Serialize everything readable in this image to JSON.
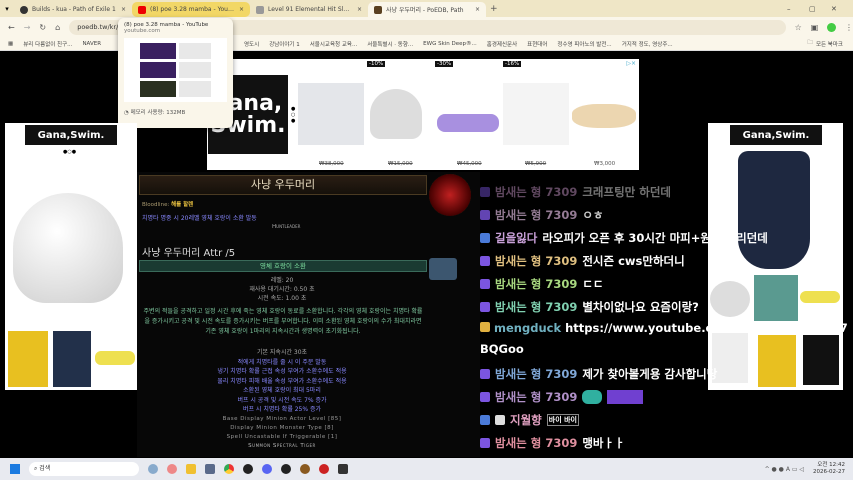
{
  "tabs": [
    {
      "title": "Builds - kua - Path of Exile 1",
      "active": false
    },
    {
      "title": "(8) poe 3.28 mamba - YouTube",
      "active": false,
      "highlighted": true
    },
    {
      "title": "Level 91 Elemental Hit Slayer",
      "active": false
    },
    {
      "title": "사냥 우두머리 - PoEDB, Path",
      "active": true
    }
  ],
  "address": {
    "url": "poedb.tw/kr/"
  },
  "bookmarks": [
    "뷰리 다름없이 친구...",
    "NAVER",
    "영도시",
    "강남이야기 1",
    "서울시교육청 교육...",
    "서울특별시 · 동향...",
    "EWG Skin Deep®...",
    "홈경제신문사",
    "표현대어",
    "정수영 피아노의 발전...",
    "거지적 정도, 영상주..."
  ],
  "bookmarks_all": "모든 북마크",
  "tab_popup": {
    "title": "(8) poe 3.28 mamba - YouTube",
    "domain": "youtube.com",
    "memory": "메모리 사용량: 132MB"
  },
  "top_ad": {
    "brand": "Gana,\nSwim.",
    "discounts": [
      "-10%",
      "-30%",
      "-16%"
    ],
    "prices": [
      "₩38,000",
      "₩15,000",
      "₩45,000",
      "₩5,900",
      "₩3,000"
    ]
  },
  "side_ad": {
    "brand": "Gana,Swim."
  },
  "item": {
    "title": "사냥 우두머리",
    "bloodline_label": "Bloodline:",
    "bloodline_value": "해를 할렌",
    "effect": "치명타 명중 시 20레벨 영체 호랑이 소환 발동",
    "tag": "Huntleader",
    "attr_title": "사냥 우두머리 Attr /5",
    "gem_name": "영체 호랑이 소환",
    "level": "레벨: 20",
    "cooldown": "재사용 대기시간: 0.50 초",
    "cast_time": "시전 속도: 1.00 초",
    "description": "주변의 적들을 공격하고 일정 시간 후에 죽는 영체 호랑이 동료를 소환합니다. 각각의 영체 호랑이는 치명타 확률을 증가시키고 공격 및 시전 속도를 증가시키는 버프를 부여합니다. 이미 소환된 영체 호랑이의 수가 최대치라면 기존 영체 호랑이 1마리의 지속시간과 생명력이 초기화됩니다.",
    "mods": [
      "기본 지속시간 30초",
      "적에게 치명타를 줄 시 이 주문 발동",
      "냉기 치명타 확률 근접 속성 부여가 소환수에도 적용",
      "물리 치명타 피해 배율 속성 부여가 소환수에도 적용",
      "소환된 영체 호랑이 최대 5마리",
      "버프 시 공격 및 시전 속도 7% 증가",
      "버프 시 치명타 확률 25% 증가"
    ],
    "props": [
      "Base Display Minion Actor Level [85]",
      "Display Minion Monster Type [8]",
      "Spell Uncastable If Triggerable [1]",
      "Summon Spectral Tiger"
    ]
  },
  "chat": [
    {
      "nick": "밤새는 형 7309",
      "text": "크래프팅만 하던데",
      "color": "#7c6a9a"
    },
    {
      "nick": "밤새는 형 7309",
      "text": "ㅇㅎ",
      "color": "#b99ab9"
    },
    {
      "nick": "길을잃다",
      "text": "라오피가 오픈 후 30시간 마피+원지 지리던데",
      "color": "#c8a0d8"
    },
    {
      "nick": "밤새는 형 7309",
      "text": "전시즌 cws만하더니",
      "color": "#e0c080"
    },
    {
      "nick": "밤새는 형 7309",
      "text": "ㄷㄷ",
      "color": "#a8d880"
    },
    {
      "nick": "밤새는 형 7309",
      "text": "별차이없나요 요즘이랑?",
      "color": "#80d0b0"
    },
    {
      "nick": "mengduck",
      "text": "https://www.youtube.com/watch?v=ongS07BQGoo",
      "color": "#70b0c0"
    },
    {
      "nick": "밤새는 형 7309",
      "text": "제가 찾아볼게용 감사합니당",
      "color": "#80a8d8"
    },
    {
      "nick": "밤새는 형 7309",
      "text": "",
      "color": "#b090c8"
    },
    {
      "nick": "지월향",
      "text": "바이 바이",
      "color": "#e0a0c0"
    },
    {
      "nick": "밤새는 형 7309",
      "text": "맹바ㅏㅏ",
      "color": "#e090a0"
    }
  ],
  "taskbar": {
    "search": "검색",
    "time": "오전 12:42",
    "date": "2026-02-27"
  }
}
